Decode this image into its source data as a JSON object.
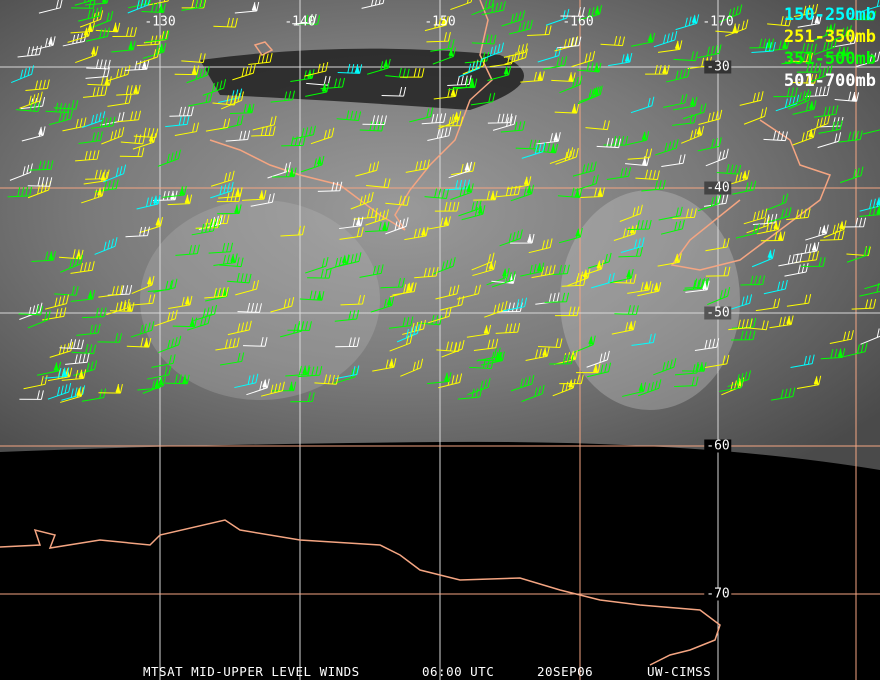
{
  "title_parts": {
    "product": "MTSAT MID-UPPER LEVEL WINDS",
    "time": "06:00 UTC",
    "date": "20SEP06",
    "source": "UW-CIMSS"
  },
  "legend": [
    {
      "label": "150-250mb",
      "color": "#00ffff"
    },
    {
      "label": "251-350mb",
      "color": "#ffff00"
    },
    {
      "label": "351-500mb",
      "color": "#00ff00"
    },
    {
      "label": "501-700mb",
      "color": "#ffffff"
    }
  ],
  "longitude_labels": [
    "-130",
    "-140",
    "-150",
    "-160",
    "-170"
  ],
  "latitude_labels": [
    "-30",
    "-40",
    "-50",
    "-60",
    "-70"
  ],
  "colors": {
    "coast": "#f4a582",
    "grid_white": "#d8d8d8",
    "grid_orange": "#f4a582"
  }
}
